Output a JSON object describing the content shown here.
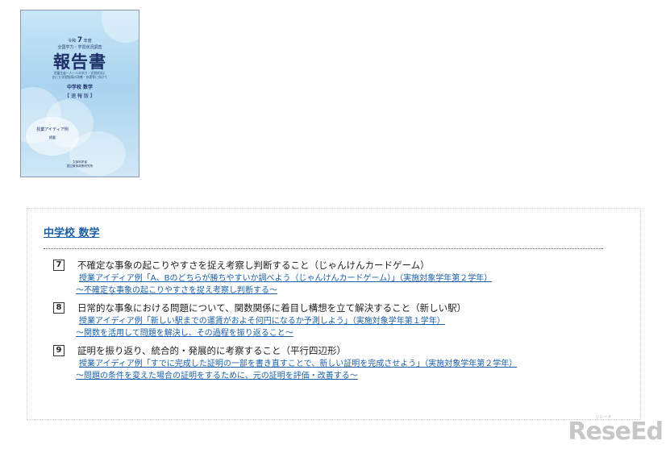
{
  "cover": {
    "reiwa_prefix": "令和",
    "reiwa_year": "7",
    "reiwa_suffix": "年度",
    "survey": "全国学力・学習状況調査",
    "title": "報告書",
    "desc_1": "児童生徒一人一人の学力・学習状況に",
    "desc_2": "応じた学習指導の改善・充実等に向けて",
    "subject": "中学校 数学",
    "edition": "【 速 報 版 】",
    "idea_label": "授業アイディア例",
    "idea_sub": "掲載",
    "org_1": "文部科学省",
    "org_2": "国立教育政策研究所"
  },
  "section": {
    "heading": "中学校 数学",
    "items": [
      {
        "num": "7",
        "title": "不確定な事象の起こりやすさを捉え考察し判断すること（じゃんけんカードゲーム）",
        "link1": "授業アイディア例「A、Bのどちらが勝ちやすいか調べよう（じゃんけんカードゲーム）」（実施対象学年第２学年）",
        "link2": "～不確定な事象の起こりやすさを捉え考察し判断する～"
      },
      {
        "num": "8",
        "title": "日常的な事象における問題について、関数関係に着目し構想を立て解決すること（新しい駅）",
        "link1": "授業アイディア例「新しい駅までの運賃がおよそ何円になるか予測しよう」（実施対象学年第１学年）",
        "link2": "～関数を活用して問題を解決し、その過程を振り返ること～"
      },
      {
        "num": "9",
        "title": "証明を振り返り、統合的・発展的に考察すること（平行四辺形）",
        "link1": "授業アイディア例「すでに完成した証明の一部を書き直すことで、新しい証明を完成させよう」（実施対象学年第２学年）",
        "link2": "～問題の条件を変えた場合の証明をするために、元の証明を評価・改善する～"
      }
    ]
  },
  "logo": {
    "text": "ReseEd",
    "tag": "リシード"
  }
}
